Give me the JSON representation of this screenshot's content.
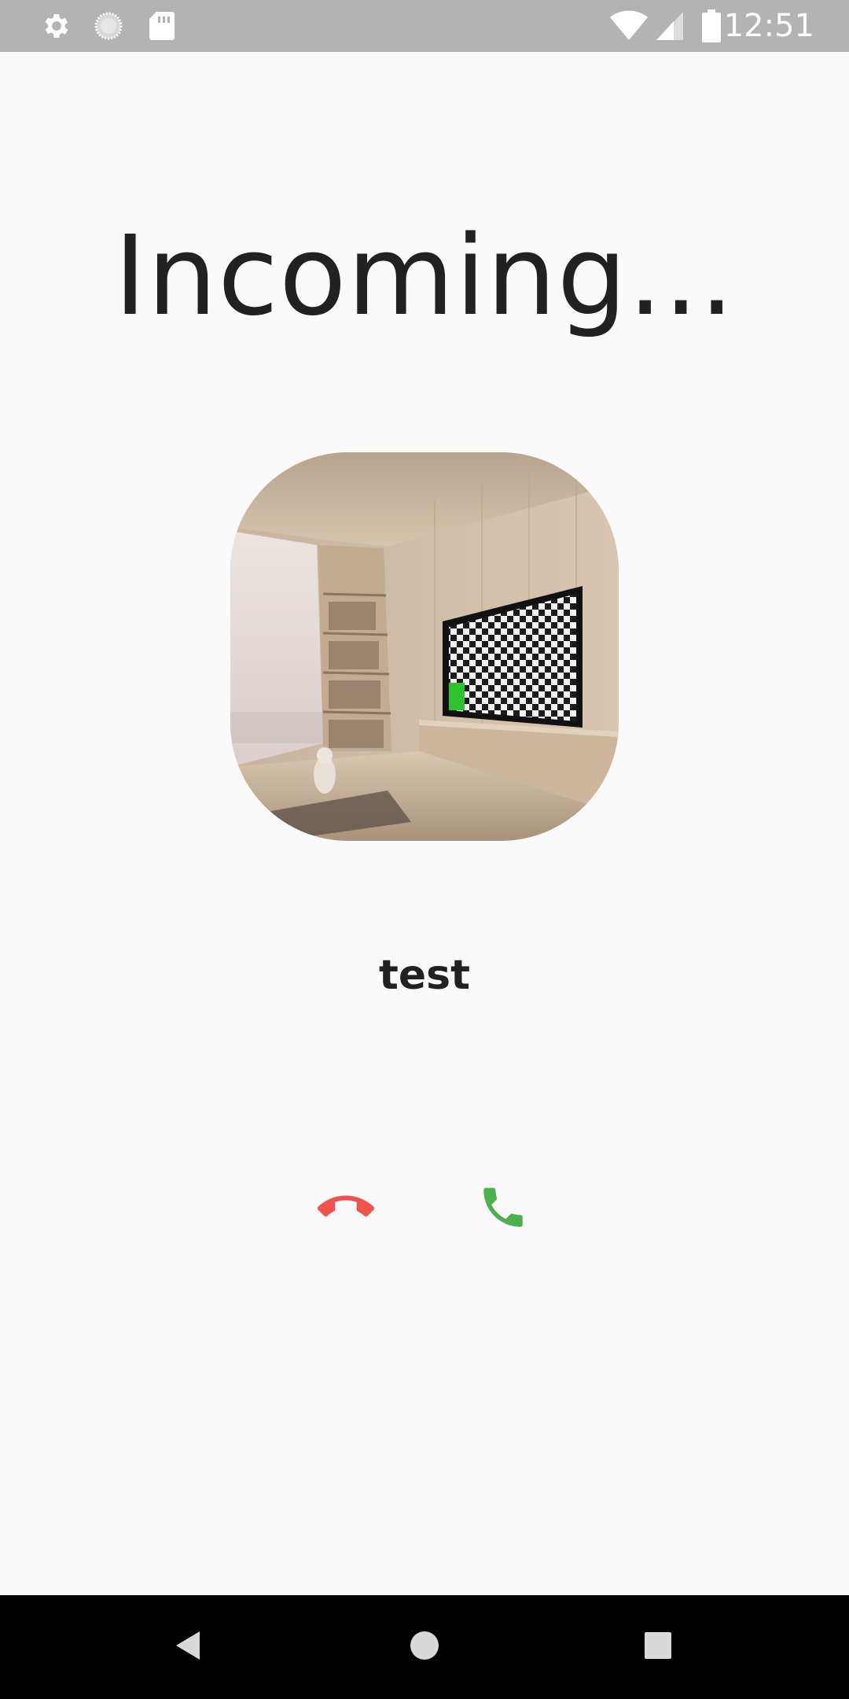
{
  "status_bar": {
    "time": "12:51",
    "icons_left": [
      "settings-icon",
      "loading-icon",
      "sd-card-icon"
    ],
    "icons_right": [
      "wifi-icon",
      "cell-signal-icon",
      "battery-icon"
    ]
  },
  "call": {
    "title": "Incoming...",
    "caller_name": "test",
    "avatar_icon": "caller-avatar-photo"
  },
  "actions": {
    "decline_icon": "call-end-icon",
    "accept_icon": "call-accept-icon"
  },
  "nav_bar": {
    "icons": [
      "back-icon",
      "home-icon",
      "recents-icon"
    ]
  },
  "colors": {
    "background": "#fafafa",
    "status_bar": "#b3b3b3",
    "decline": "#ef5350",
    "accept": "#4caf50",
    "text": "#212121",
    "nav_bar": "#000000"
  }
}
